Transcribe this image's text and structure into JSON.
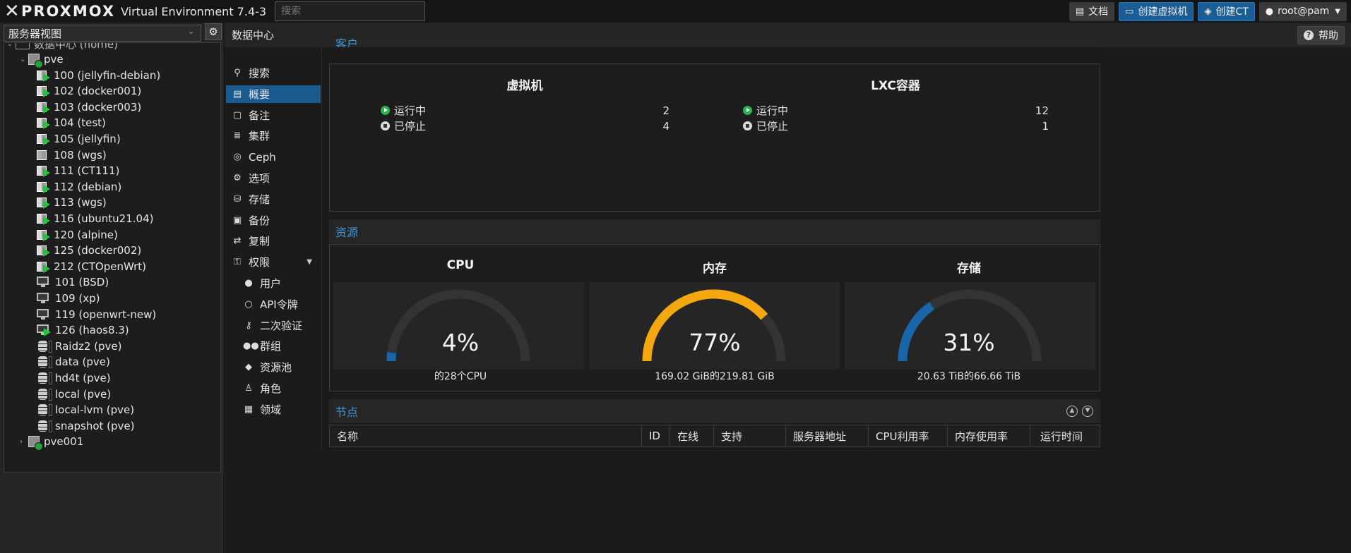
{
  "header": {
    "logo_text": "PROXMOX",
    "version": "Virtual Environment 7.4-3",
    "search_placeholder": "搜索",
    "buttons": [
      {
        "label": "文档",
        "icon": "book-icon"
      },
      {
        "label": "创建虚拟机",
        "icon": "monitor-icon"
      },
      {
        "label": "创建CT",
        "icon": "cube-icon"
      },
      {
        "label": "root@pam",
        "icon": "user-icon"
      }
    ]
  },
  "tree": {
    "view_selector": "服务器视图",
    "root_label": "数据中心 (home)",
    "nodes": [
      {
        "label": "pve",
        "type": "node",
        "expanded": true
      },
      {
        "label": "100 (jellyfin-debian)",
        "type": "ct-running"
      },
      {
        "label": "102 (docker001)",
        "type": "ct-running"
      },
      {
        "label": "103 (docker003)",
        "type": "ct-running"
      },
      {
        "label": "104 (test)",
        "type": "ct-running"
      },
      {
        "label": "105 (jellyfin)",
        "type": "ct-running"
      },
      {
        "label": "108 (wgs)",
        "type": "ct-stopped"
      },
      {
        "label": "111 (CT111)",
        "type": "ct-running"
      },
      {
        "label": "112 (debian)",
        "type": "ct-running"
      },
      {
        "label": "113 (wgs)",
        "type": "ct-running"
      },
      {
        "label": "116 (ubuntu21.04)",
        "type": "ct-running"
      },
      {
        "label": "120 (alpine)",
        "type": "ct-running"
      },
      {
        "label": "125 (docker002)",
        "type": "ct-running"
      },
      {
        "label": "212 (CTOpenWrt)",
        "type": "ct-running"
      },
      {
        "label": "101 (BSD)",
        "type": "vm-stopped"
      },
      {
        "label": "109 (xp)",
        "type": "vm-stopped"
      },
      {
        "label": "119 (openwrt-new)",
        "type": "vm-stopped"
      },
      {
        "label": "126 (haos8.3)",
        "type": "vm-running"
      },
      {
        "label": "Raidz2 (pve)",
        "type": "storage"
      },
      {
        "label": "data (pve)",
        "type": "storage"
      },
      {
        "label": "hd4t (pve)",
        "type": "storage"
      },
      {
        "label": "local (pve)",
        "type": "storage"
      },
      {
        "label": "local-lvm (pve)",
        "type": "storage"
      },
      {
        "label": "snapshot (pve)",
        "type": "storage"
      },
      {
        "label": "pve001",
        "type": "node",
        "expanded": false
      }
    ]
  },
  "main": {
    "title": "数据中心",
    "help_label": "帮助"
  },
  "nav": [
    {
      "label": "搜索",
      "icon": "search-icon",
      "active": false,
      "sub": false
    },
    {
      "label": "概要",
      "icon": "book-icon",
      "active": true,
      "sub": false
    },
    {
      "label": "备注",
      "icon": "note-icon",
      "active": false,
      "sub": false
    },
    {
      "label": "集群",
      "icon": "server-icon",
      "active": false,
      "sub": false
    },
    {
      "label": "Ceph",
      "icon": "ceph-icon",
      "active": false,
      "sub": false
    },
    {
      "label": "选项",
      "icon": "gear-icon",
      "active": false,
      "sub": false
    },
    {
      "label": "存储",
      "icon": "database-icon",
      "active": false,
      "sub": false
    },
    {
      "label": "备份",
      "icon": "floppy-icon",
      "active": false,
      "sub": false
    },
    {
      "label": "复制",
      "icon": "retweet-icon",
      "active": false,
      "sub": false
    },
    {
      "label": "权限",
      "icon": "unlock-icon",
      "active": false,
      "sub": false,
      "dropdown": true
    },
    {
      "label": "用户",
      "icon": "user-icon",
      "active": false,
      "sub": true
    },
    {
      "label": "API令牌",
      "icon": "user-outline-icon",
      "active": false,
      "sub": true
    },
    {
      "label": "二次验证",
      "icon": "key-icon",
      "active": false,
      "sub": true
    },
    {
      "label": "群组",
      "icon": "users-icon",
      "active": false,
      "sub": true
    },
    {
      "label": "资源池",
      "icon": "tags-icon",
      "active": false,
      "sub": true
    },
    {
      "label": "角色",
      "icon": "male-icon",
      "active": false,
      "sub": true
    },
    {
      "label": "领域",
      "icon": "address-book-icon",
      "active": false,
      "sub": true
    }
  ],
  "guests": {
    "title": "客户",
    "vm": {
      "title": "虚拟机",
      "running_label": "运行中",
      "running": "2",
      "stopped_label": "已停止",
      "stopped": "4"
    },
    "lxc": {
      "title": "LXC容器",
      "running_label": "运行中",
      "running": "12",
      "stopped_label": "已停止",
      "stopped": "1"
    }
  },
  "resources": {
    "title": "资源",
    "gauges": [
      {
        "label": "CPU",
        "percent_text": "4%",
        "fraction": 0.04,
        "detail": "的28个CPU",
        "color": "#1a64a8"
      },
      {
        "label": "内存",
        "percent_text": "77%",
        "fraction": 0.77,
        "detail": "169.02 GiB的219.81 GiB",
        "color": "#f5a70f"
      },
      {
        "label": "存储",
        "percent_text": "31%",
        "fraction": 0.31,
        "detail": "20.63 TiB的66.66 TiB",
        "color": "#1a64a8"
      }
    ]
  },
  "nodes_section": {
    "title": "节点",
    "columns": [
      "名称",
      "ID",
      "在线",
      "支持",
      "服务器地址",
      "CPU利用率",
      "内存使用率",
      "运行时间"
    ]
  }
}
